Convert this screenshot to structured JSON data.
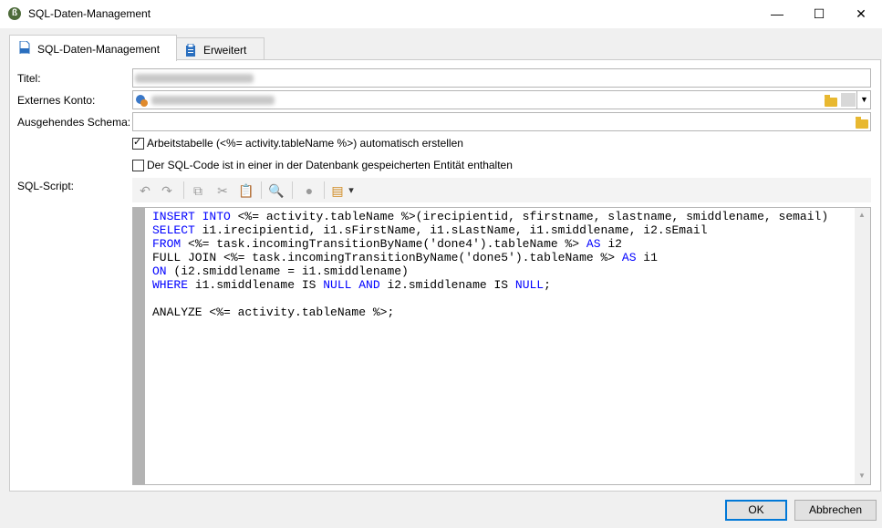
{
  "window": {
    "title": "SQL-Daten-Management",
    "minimize_glyph": "—",
    "maximize_glyph": "☐",
    "close_glyph": "✕"
  },
  "tabs": [
    {
      "label": "SQL-Daten-Management",
      "icon": "sql-file-icon",
      "active": true
    },
    {
      "label": "Erweitert",
      "icon": "clipboard-icon",
      "active": false
    }
  ],
  "form": {
    "titel_label": "Titel:",
    "konto_label": "Externes Konto:",
    "schema_label": "Ausgehendes Schema:",
    "script_label": "SQL-Script:",
    "check_auto_label": "Arbeitstabelle (<%= activity.tableName %>) automatisch erstellen",
    "check_auto_checked": true,
    "check_entity_label": "Der SQL-Code ist in einer in der Datenbank gespeicherten Entität enthalten",
    "check_entity_checked": false
  },
  "toolbar": {
    "undo": "↶",
    "redo": "↷",
    "copy": "⧉",
    "cut": "✂",
    "paste": "📋",
    "find": "🔍",
    "check": "●",
    "insert": "▤",
    "dropdown": "▾"
  },
  "code": {
    "lines": [
      [
        {
          "k": 1,
          "t": "INSERT INTO"
        },
        {
          "k": 0,
          "t": " <%= activity.tableName %>(irecipientid, sfirstname, slastname, smiddlename, semail)"
        }
      ],
      [
        {
          "k": 1,
          "t": "SELECT"
        },
        {
          "k": 0,
          "t": " i1.irecipientid, i1.sFirstName, i1.sLastName, i1.smiddlename, i2.sEmail"
        }
      ],
      [
        {
          "k": 1,
          "t": "FROM"
        },
        {
          "k": 0,
          "t": " <%= task.incomingTransitionByName('done4').tableName %> "
        },
        {
          "k": 1,
          "t": "AS"
        },
        {
          "k": 0,
          "t": " i2"
        }
      ],
      [
        {
          "k": 0,
          "t": "FULL JOIN <%= task.incomingTransitionByName('done5').tableName %> "
        },
        {
          "k": 1,
          "t": "AS"
        },
        {
          "k": 0,
          "t": " i1"
        }
      ],
      [
        {
          "k": 1,
          "t": "ON"
        },
        {
          "k": 0,
          "t": " (i2.smiddlename = i1.smiddlename)"
        }
      ],
      [
        {
          "k": 1,
          "t": "WHERE"
        },
        {
          "k": 0,
          "t": " i1.smiddlename IS "
        },
        {
          "k": 1,
          "t": "NULL AND"
        },
        {
          "k": 0,
          "t": " i2.smiddlename IS "
        },
        {
          "k": 1,
          "t": "NULL"
        },
        {
          "k": 0,
          "t": ";"
        }
      ],
      [
        {
          "k": 0,
          "t": ""
        }
      ],
      [
        {
          "k": 0,
          "t": "ANALYZE <%= activity.tableName %>;"
        }
      ]
    ]
  },
  "buttons": {
    "ok": "OK",
    "cancel": "Abbrechen"
  },
  "colors": {
    "keyword": "#0000ff",
    "gutter": "#b3b3b3"
  }
}
